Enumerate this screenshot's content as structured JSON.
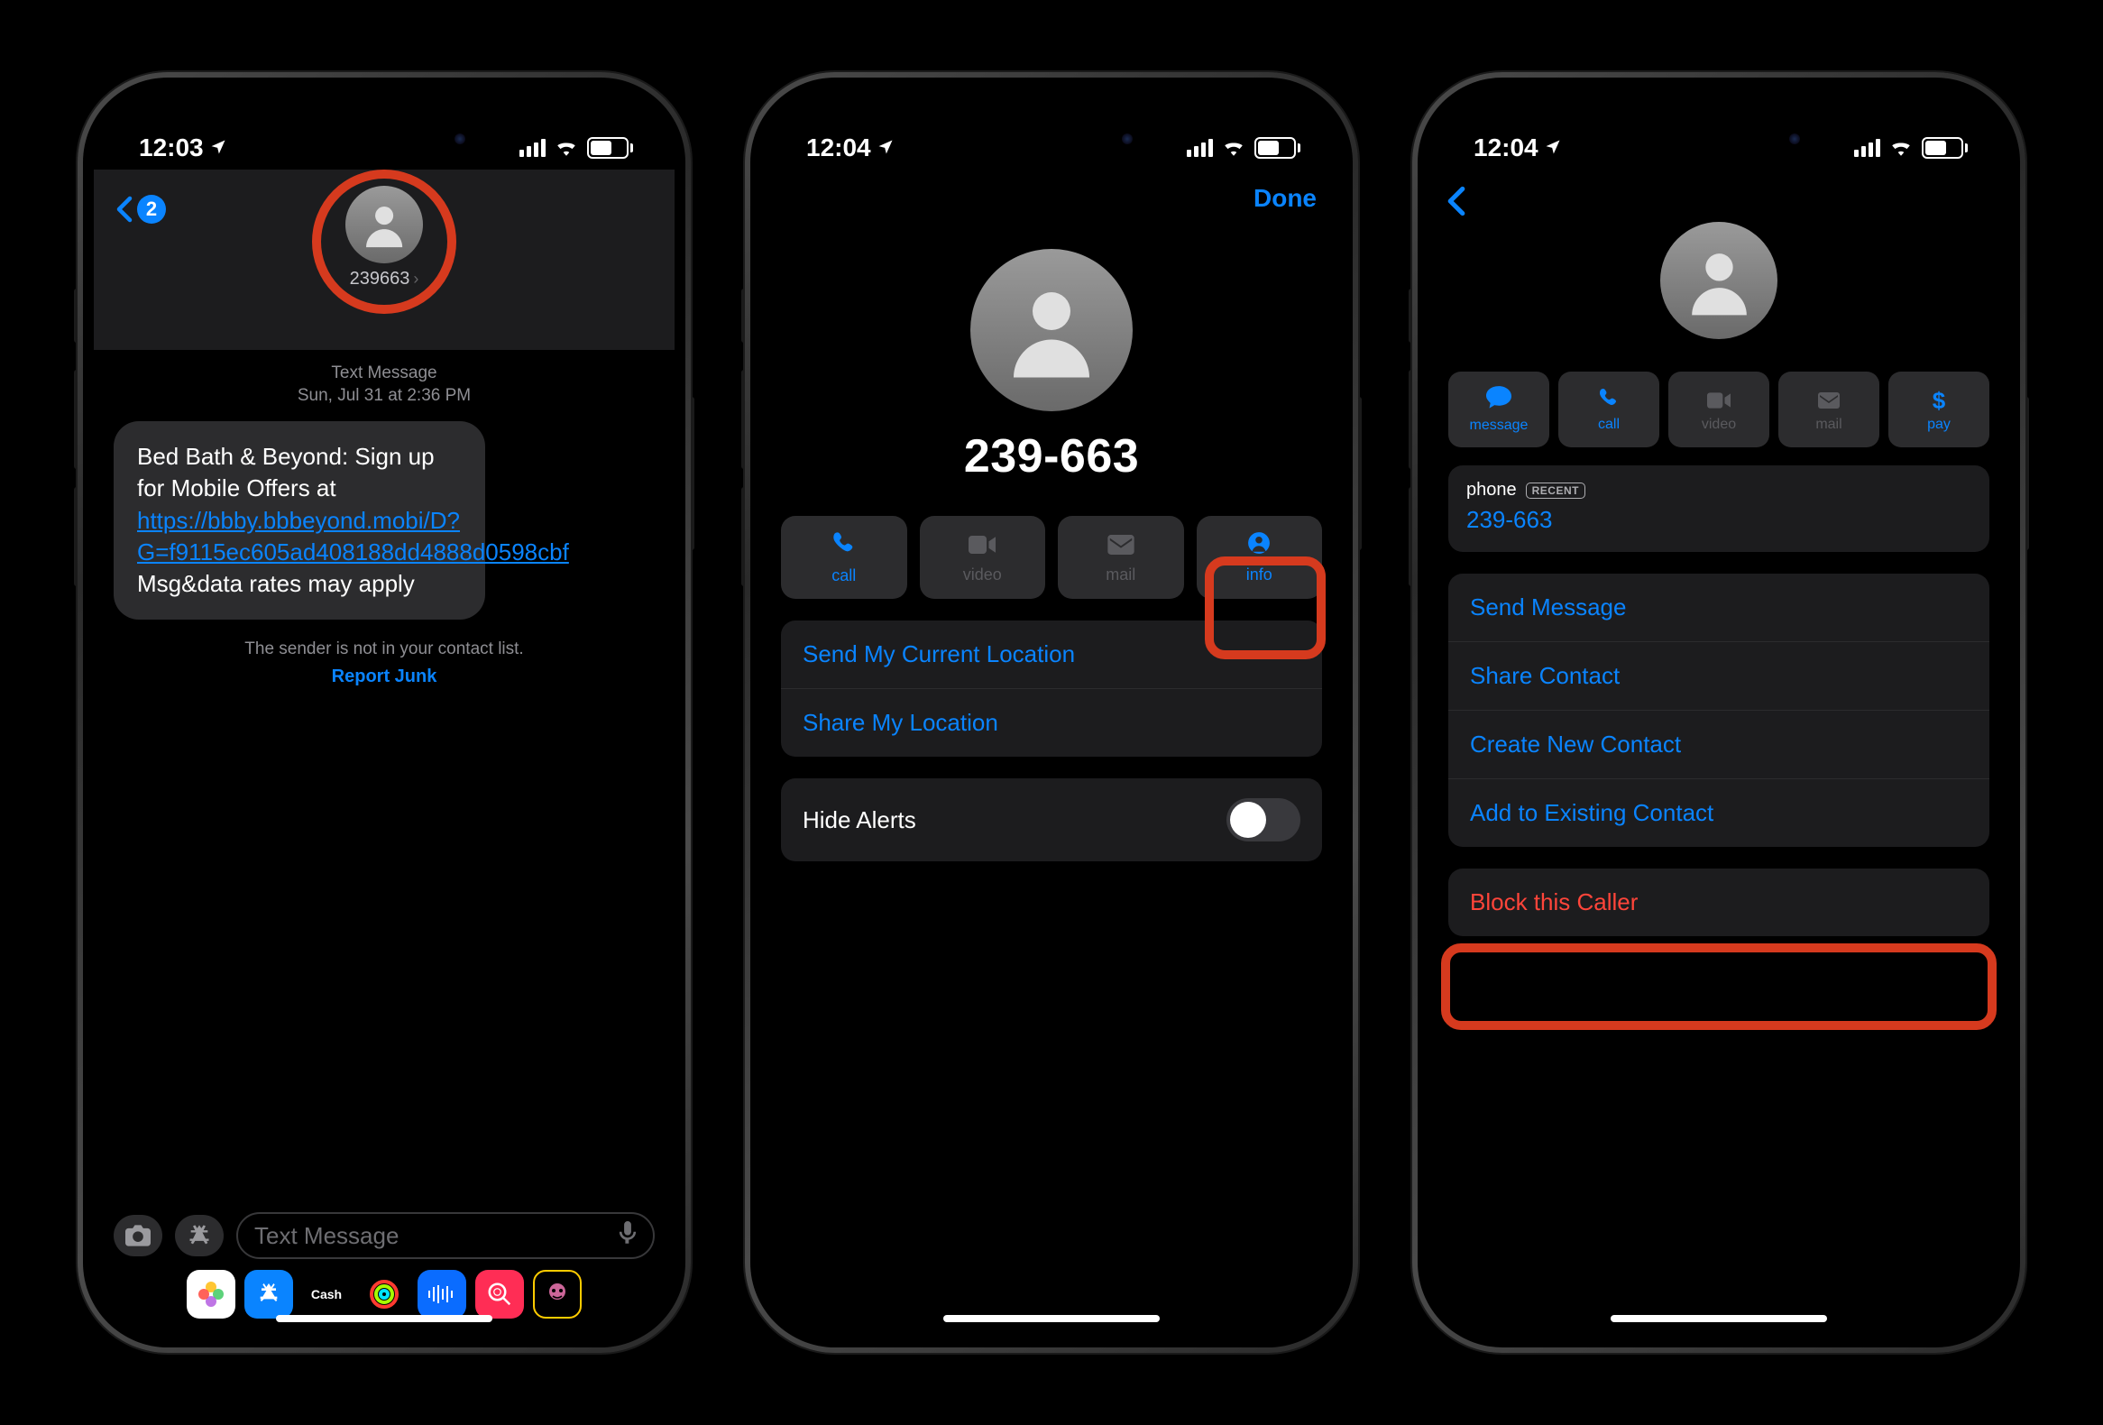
{
  "status": {
    "battery": "54"
  },
  "screen1": {
    "time": "12:03",
    "back_badge": "2",
    "contact_name": "239663",
    "meta_line1": "Text Message",
    "meta_line2": "Sun, Jul 31 at 2:36 PM",
    "msg_before": "Bed Bath & Beyond: Sign up for Mobile Offers at ",
    "msg_link": "https://bbby.bbbeyond.mobi/D?G=f9115ec605ad408188dd4888d0598cbf",
    "msg_after": " Msg&data rates may apply",
    "warn": "The sender is not in your contact list.",
    "report": "Report Junk",
    "placeholder": "Text Message",
    "dock_cash": "Cash"
  },
  "screen2": {
    "time": "12:04",
    "done": "Done",
    "name": "239-663",
    "actions": {
      "call": "call",
      "video": "video",
      "mail": "mail",
      "info": "info"
    },
    "rows": {
      "send_loc": "Send My Current Location",
      "share_loc": "Share My Location",
      "hide_alerts": "Hide Alerts"
    }
  },
  "screen3": {
    "time": "12:04",
    "actions": {
      "message": "message",
      "call": "call",
      "video": "video",
      "mail": "mail",
      "pay": "pay"
    },
    "phone_label": "phone",
    "recent": "RECENT",
    "phone_value": "239-663",
    "rows": {
      "send_msg": "Send Message",
      "share_contact": "Share Contact",
      "create_contact": "Create New Contact",
      "add_existing": "Add to Existing Contact",
      "block": "Block this Caller"
    }
  }
}
